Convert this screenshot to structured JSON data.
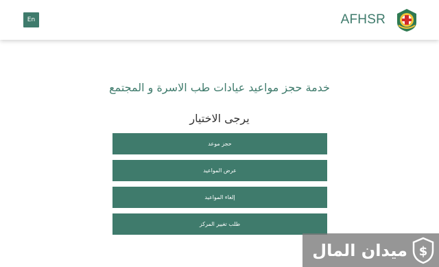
{
  "header": {
    "lang_button": "En",
    "brand_name": "AFHSR"
  },
  "main": {
    "title": "خدمة حجز مواعيد عيادات طب الاسرة و المجتمع",
    "subtitle": "يرجى الاختيار",
    "options": [
      {
        "label": "حجز موعد"
      },
      {
        "label": "عرض المواعيد"
      },
      {
        "label": "إلغاء المواعيد"
      },
      {
        "label": "طلب تغيير المركز"
      }
    ]
  },
  "watermark": {
    "text": "ميدان المال"
  },
  "colors": {
    "accent": "#3f7b6c",
    "text_dark": "#333333",
    "watermark_bg": "#787878"
  },
  "icons": {
    "logo": "afhsr-emblem-icon",
    "watermark": "money-shield-icon"
  }
}
